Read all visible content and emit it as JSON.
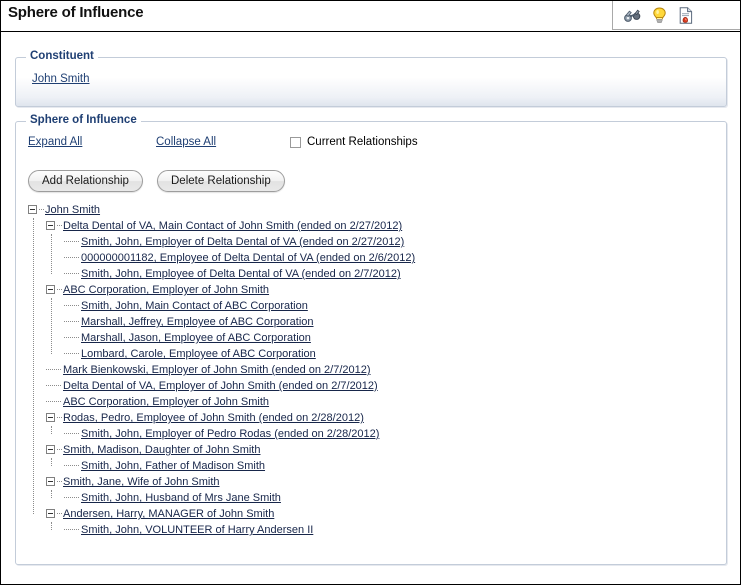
{
  "header": {
    "title": "Sphere of Influence",
    "toolbar": [
      {
        "name": "binoculars-icon",
        "label": "Search"
      },
      {
        "name": "lightbulb-icon",
        "label": "Tips"
      },
      {
        "name": "report-document-icon",
        "label": "Report"
      }
    ]
  },
  "constituent": {
    "legend": "Constituent",
    "name": "John Smith"
  },
  "sphere": {
    "legend": "Sphere of Influence",
    "expand_all": "Expand All",
    "collapse_all": "Collapse All",
    "current_relationships_label": "Current Relationships",
    "current_relationships_checked": false,
    "add_button": "Add Relationship",
    "delete_button": "Delete Relationship"
  },
  "tree": [
    {
      "level": 0,
      "expander": "minus",
      "label": "John Smith"
    },
    {
      "level": 1,
      "expander": "minus",
      "label": "Delta Dental of VA, Main Contact of John Smith (ended on 2/27/2012)"
    },
    {
      "level": 2,
      "expander": "none",
      "label": "Smith, John, Employer of Delta Dental of VA (ended on 2/27/2012)"
    },
    {
      "level": 2,
      "expander": "none",
      "label": "000000001182, Employee of Delta Dental of VA (ended on 2/6/2012)"
    },
    {
      "level": 2,
      "expander": "none",
      "label": "Smith, John, Employee of Delta Dental of VA (ended on 2/7/2012)"
    },
    {
      "level": 1,
      "expander": "minus",
      "label": "ABC Corporation, Employer of John Smith"
    },
    {
      "level": 2,
      "expander": "none",
      "label": "Smith, John, Main Contact of ABC Corporation"
    },
    {
      "level": 2,
      "expander": "none",
      "label": "Marshall, Jeffrey, Employee of ABC Corporation"
    },
    {
      "level": 2,
      "expander": "none",
      "label": "Marshall, Jason, Employee of ABC Corporation"
    },
    {
      "level": 2,
      "expander": "none",
      "label": "Lombard, Carole, Employee of ABC Corporation"
    },
    {
      "level": 1,
      "expander": "none",
      "label": "Mark Bienkowski, Employer of John Smith (ended on 2/7/2012)"
    },
    {
      "level": 1,
      "expander": "none",
      "label": "Delta Dental of VA, Employer of John Smith (ended on 2/7/2012)"
    },
    {
      "level": 1,
      "expander": "none",
      "label": "ABC Corporation, Employer of John Smith"
    },
    {
      "level": 1,
      "expander": "minus",
      "label": "Rodas, Pedro, Employee of John Smith (ended on 2/28/2012)"
    },
    {
      "level": 2,
      "expander": "none",
      "label": "Smith, John, Employer of Pedro Rodas (ended on 2/28/2012)"
    },
    {
      "level": 1,
      "expander": "minus",
      "label": "Smith, Madison, Daughter of John Smith"
    },
    {
      "level": 2,
      "expander": "none",
      "label": "Smith, John, Father of Madison Smith"
    },
    {
      "level": 1,
      "expander": "minus",
      "label": "Smith, Jane, Wife of John Smith"
    },
    {
      "level": 2,
      "expander": "none",
      "label": "Smith, John, Husband of Mrs Jane Smith"
    },
    {
      "level": 1,
      "expander": "minus",
      "label": "Andersen, Harry, MANAGER of John Smith"
    },
    {
      "level": 2,
      "expander": "none",
      "label": "Smith, John, VOLUNTEER of Harry Andersen II"
    }
  ],
  "colors": {
    "link": "#1f3f73",
    "legend": "#1f3f73",
    "fieldset_border": "#c3ccd9",
    "tree_label": "#17264a"
  }
}
